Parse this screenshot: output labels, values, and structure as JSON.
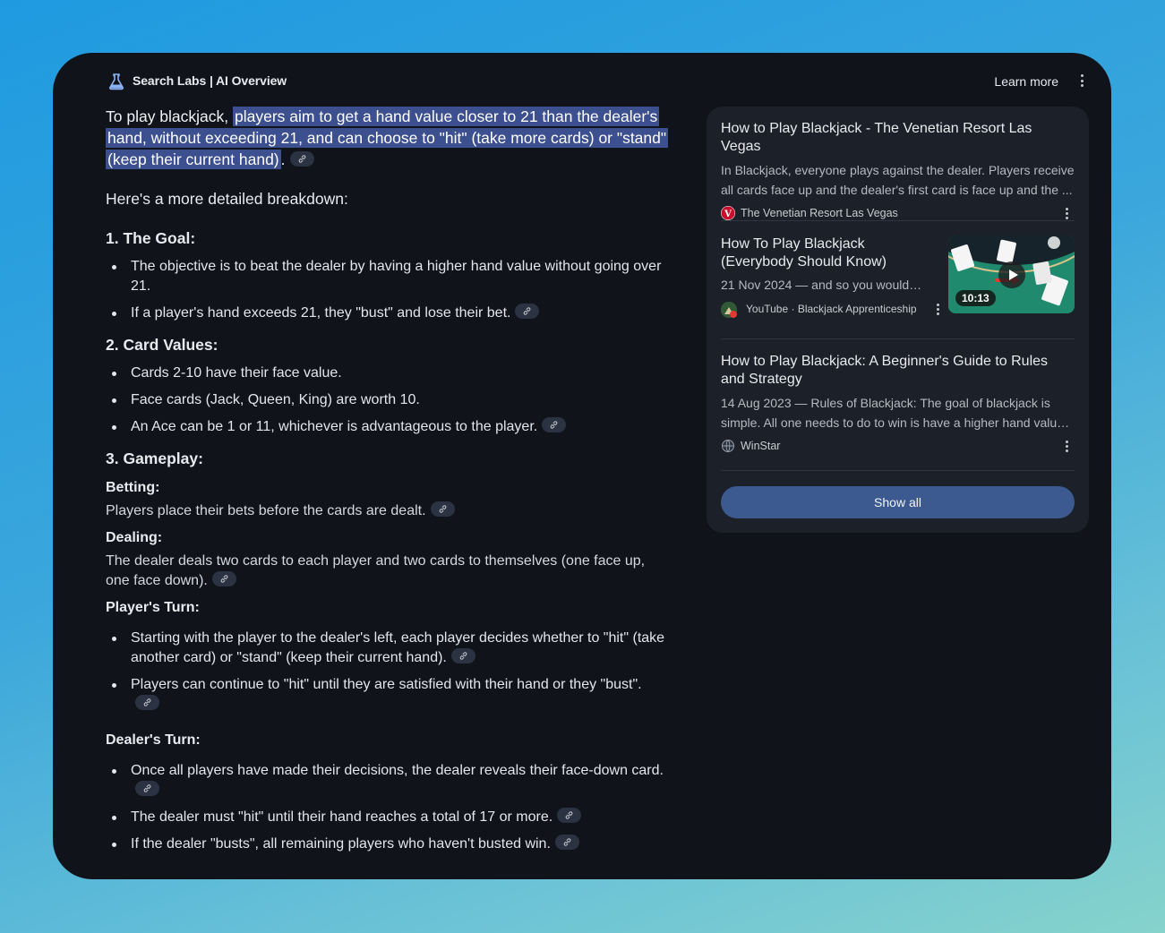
{
  "header": {
    "title": "Search Labs | AI Overview",
    "learn_more": "Learn more"
  },
  "overview": {
    "intro_prefix": "To play blackjack, ",
    "intro_highlight": "players aim to get a hand value closer to 21 than the dealer's hand, without exceeding 21, and can choose to \"hit\" (take more cards) or \"stand\" (keep their current hand)",
    "intro_suffix": ".",
    "breakdown": "Here's a more detailed breakdown:",
    "goal": {
      "heading": "1. The Goal:",
      "items": [
        "The objective is to beat the dealer by having a higher hand value without going over 21.",
        "If a player's hand exceeds 21, they \"bust\" and lose their bet."
      ]
    },
    "values": {
      "heading": "2. Card Values:",
      "items": [
        "Cards 2-10 have their face value.",
        "Face cards (Jack, Queen, King) are worth 10.",
        "An Ace can be 1 or 11, whichever is advantageous to the player."
      ]
    },
    "gameplay": {
      "heading": "3. Gameplay:",
      "betting_label": "Betting:",
      "betting_text": "Players place their bets before the cards are dealt.",
      "dealing_label": "Dealing:",
      "dealing_text": "The dealer deals two cards to each player and two cards to themselves (one face up, one face down).",
      "player_label": "Player's Turn:",
      "player_items": [
        "Starting with the player to the dealer's left, each player decides whether to \"hit\" (take another card) or \"stand\" (keep their current hand).",
        "Players can continue to \"hit\" until they are satisfied with their hand or they \"bust\"."
      ],
      "dealer_label": "Dealer's Turn:",
      "dealer_items": [
        "Once all players have made their decisions, the dealer reveals their face-down card.",
        "The dealer must \"hit\" until their hand reaches a total of 17 or more.",
        "If the dealer \"busts\", all remaining players who haven't busted win."
      ]
    }
  },
  "sources": [
    {
      "title": "How to Play Blackjack - The Venetian Resort Las Vegas",
      "snippet": "In Blackjack, everyone plays against the dealer. Players receive all cards face up and the dealer's first card is face up and the ...",
      "site": "The Venetian Resort Las Vegas",
      "favicon_letter": "V",
      "favicon_color": "#c8102e"
    },
    {
      "title": "How To Play Blackjack (Everybody Should Know)",
      "snippet": "21 Nov 2024 — and so you would…",
      "site": "YouTube · Blackjack Apprenticeship",
      "duration": "10:13"
    },
    {
      "title": "How to Play Blackjack: A Beginner's Guide to Rules and Strategy",
      "snippet": "14 Aug 2023 — Rules of Blackjack: The goal of blackjack is simple. All one needs to do to win is have a higher hand valu…",
      "site": "WinStar"
    }
  ],
  "show_all": "Show all",
  "colors": {
    "card_bg": "#10131a",
    "highlight": "#3c4f8f",
    "button": "#3c5a8f"
  }
}
